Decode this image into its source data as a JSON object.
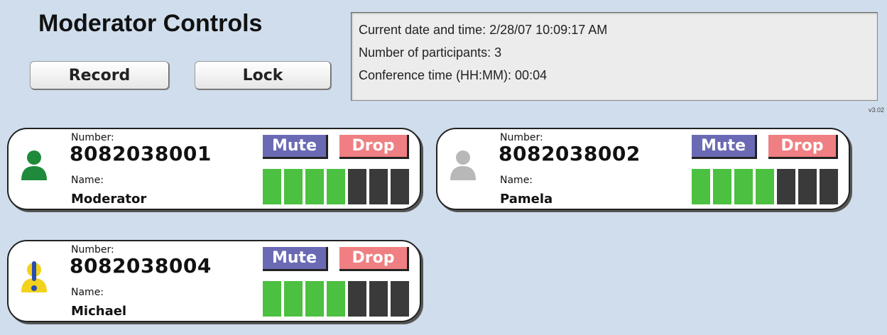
{
  "header": {
    "title": "Moderator Controls",
    "record_label": "Record",
    "lock_label": "Lock"
  },
  "info": {
    "line1": "Current date and time:  2/28/07 10:09:17 AM",
    "line2": "Number of participants:  3",
    "line3": "Conference time (HH:MM):  00:04",
    "version": "v3.02"
  },
  "colors": {
    "background": "#cfddec",
    "mute": "#6a6ab4",
    "drop": "#ef7f82",
    "meter_on": "#4cc040",
    "meter_off": "#3a3a3a"
  },
  "participants": [
    {
      "number_label": "Number:",
      "number": "8082038001",
      "name_label": "Name:",
      "name": "Moderator",
      "mute_label": "Mute",
      "drop_label": "Drop",
      "icon": "moderator-person-icon",
      "icon_color": "#1f8a3a",
      "volume_level": 4,
      "volume_max": 7
    },
    {
      "number_label": "Number:",
      "number": "8082038002",
      "name_label": "Name:",
      "name": "Pamela",
      "mute_label": "Mute",
      "drop_label": "Drop",
      "icon": "participant-person-icon",
      "icon_color": "#b8b8b8",
      "volume_level": 4,
      "volume_max": 7
    },
    {
      "number_label": "Number:",
      "number": "8082038004",
      "name_label": "Name:",
      "name": "Michael",
      "mute_label": "Mute",
      "drop_label": "Drop",
      "icon": "speaking-alert-person-icon",
      "icon_color": "#f2d21a",
      "volume_level": 4,
      "volume_max": 7
    }
  ]
}
